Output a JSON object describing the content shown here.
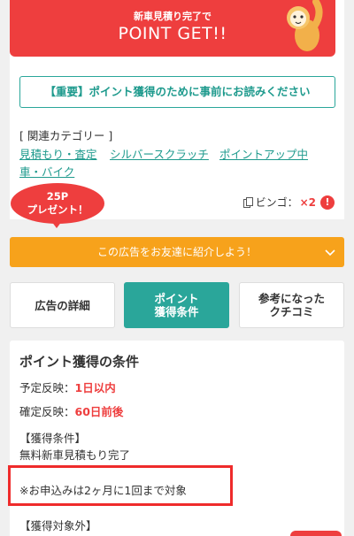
{
  "banner": {
    "subtitle": "新車見積り完了で",
    "title": "POINT GET!!"
  },
  "notice": {
    "label": "【重要】ポイント獲得のために事前にお読みください"
  },
  "related": {
    "title": "[ 関連カテゴリー ]",
    "categories": [
      "見積もり・査定",
      "シルバースクラッチ",
      "ポイントアップ中",
      "車・バイク"
    ]
  },
  "present": {
    "line1": "25P",
    "line2": "プレゼント！"
  },
  "bingo": {
    "label": "ビンゴ：",
    "multiplier": "×2",
    "alert": "!"
  },
  "share": {
    "label": "この広告をお友達に紹介しよう！"
  },
  "tabs": [
    {
      "label": "広告の詳細"
    },
    {
      "label": "ポイント\n獲得条件"
    },
    {
      "label": "参考になった\nクチコミ"
    }
  ],
  "conditions": {
    "title": "ポイント獲得の条件",
    "scheduled_label": "予定反映：",
    "scheduled_value": "1日以内",
    "confirmed_label": "確定反映：",
    "confirmed_value": "60日前後",
    "acquire_heading": "【獲得条件】",
    "acquire_text": "無料新車見積もり完了",
    "note": "※お申込みは2ヶ月に1回まで対象",
    "excluded_heading": "【獲得対象外】"
  },
  "colors": {
    "brand_red": "#ee3e3e",
    "teal": "#2aa69a",
    "orange": "#f7a21b"
  }
}
